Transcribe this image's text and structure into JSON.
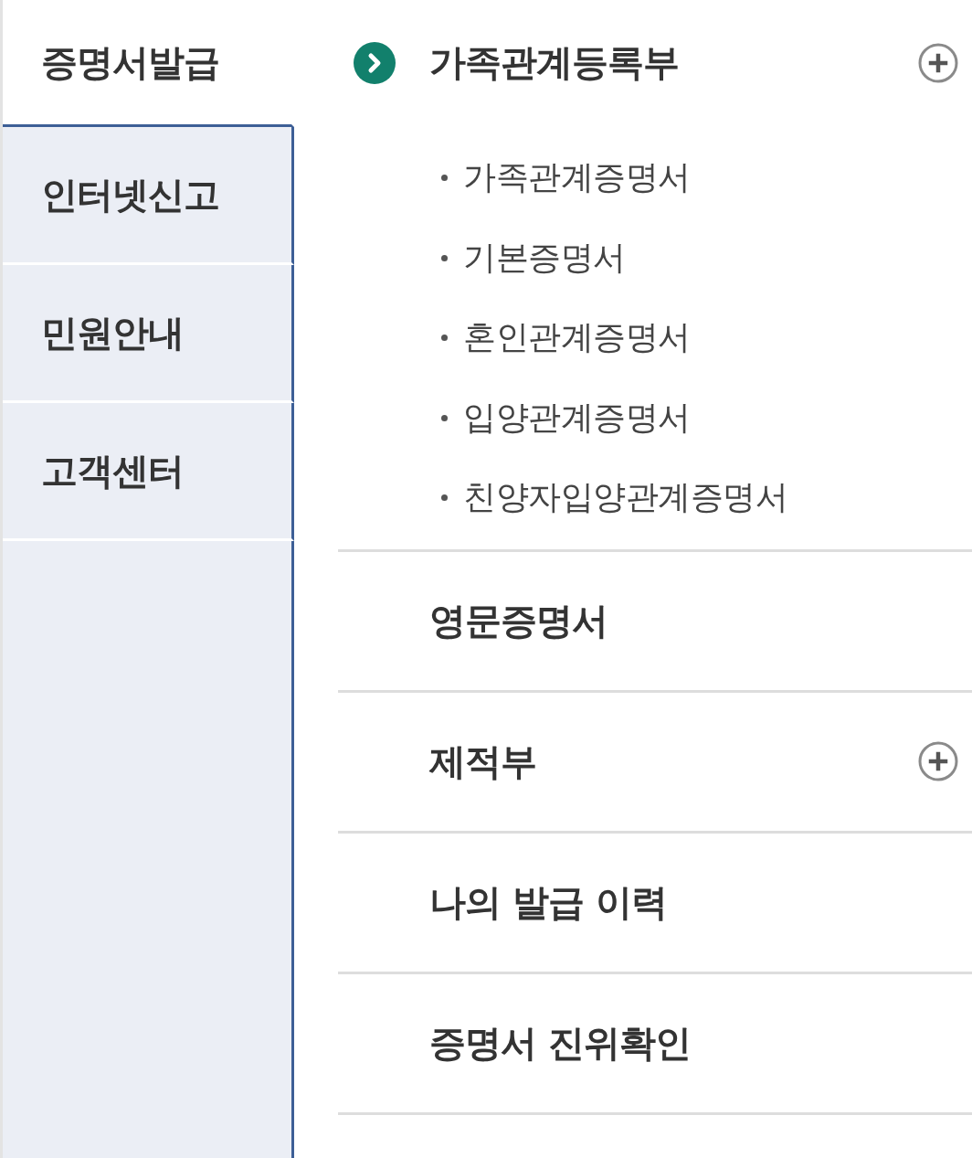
{
  "sidebar": {
    "items": [
      {
        "label": "증명서발급",
        "selected": true
      },
      {
        "label": "인터넷신고",
        "selected": false
      },
      {
        "label": "민원안내",
        "selected": false
      },
      {
        "label": "고객센터",
        "selected": false
      }
    ]
  },
  "menu": {
    "sections": [
      {
        "label": "가족관계등록부",
        "current": true,
        "expandable": true,
        "children": [
          {
            "label": "가족관계증명서"
          },
          {
            "label": "기본증명서"
          },
          {
            "label": "혼인관계증명서"
          },
          {
            "label": "입양관계증명서"
          },
          {
            "label": "친양자입양관계증명서"
          }
        ]
      },
      {
        "label": "영문증명서",
        "current": false,
        "expandable": false
      },
      {
        "label": "제적부",
        "current": false,
        "expandable": true
      },
      {
        "label": "나의 발급 이력",
        "current": false,
        "expandable": false
      },
      {
        "label": "증명서 진위확인",
        "current": false,
        "expandable": false
      }
    ]
  }
}
